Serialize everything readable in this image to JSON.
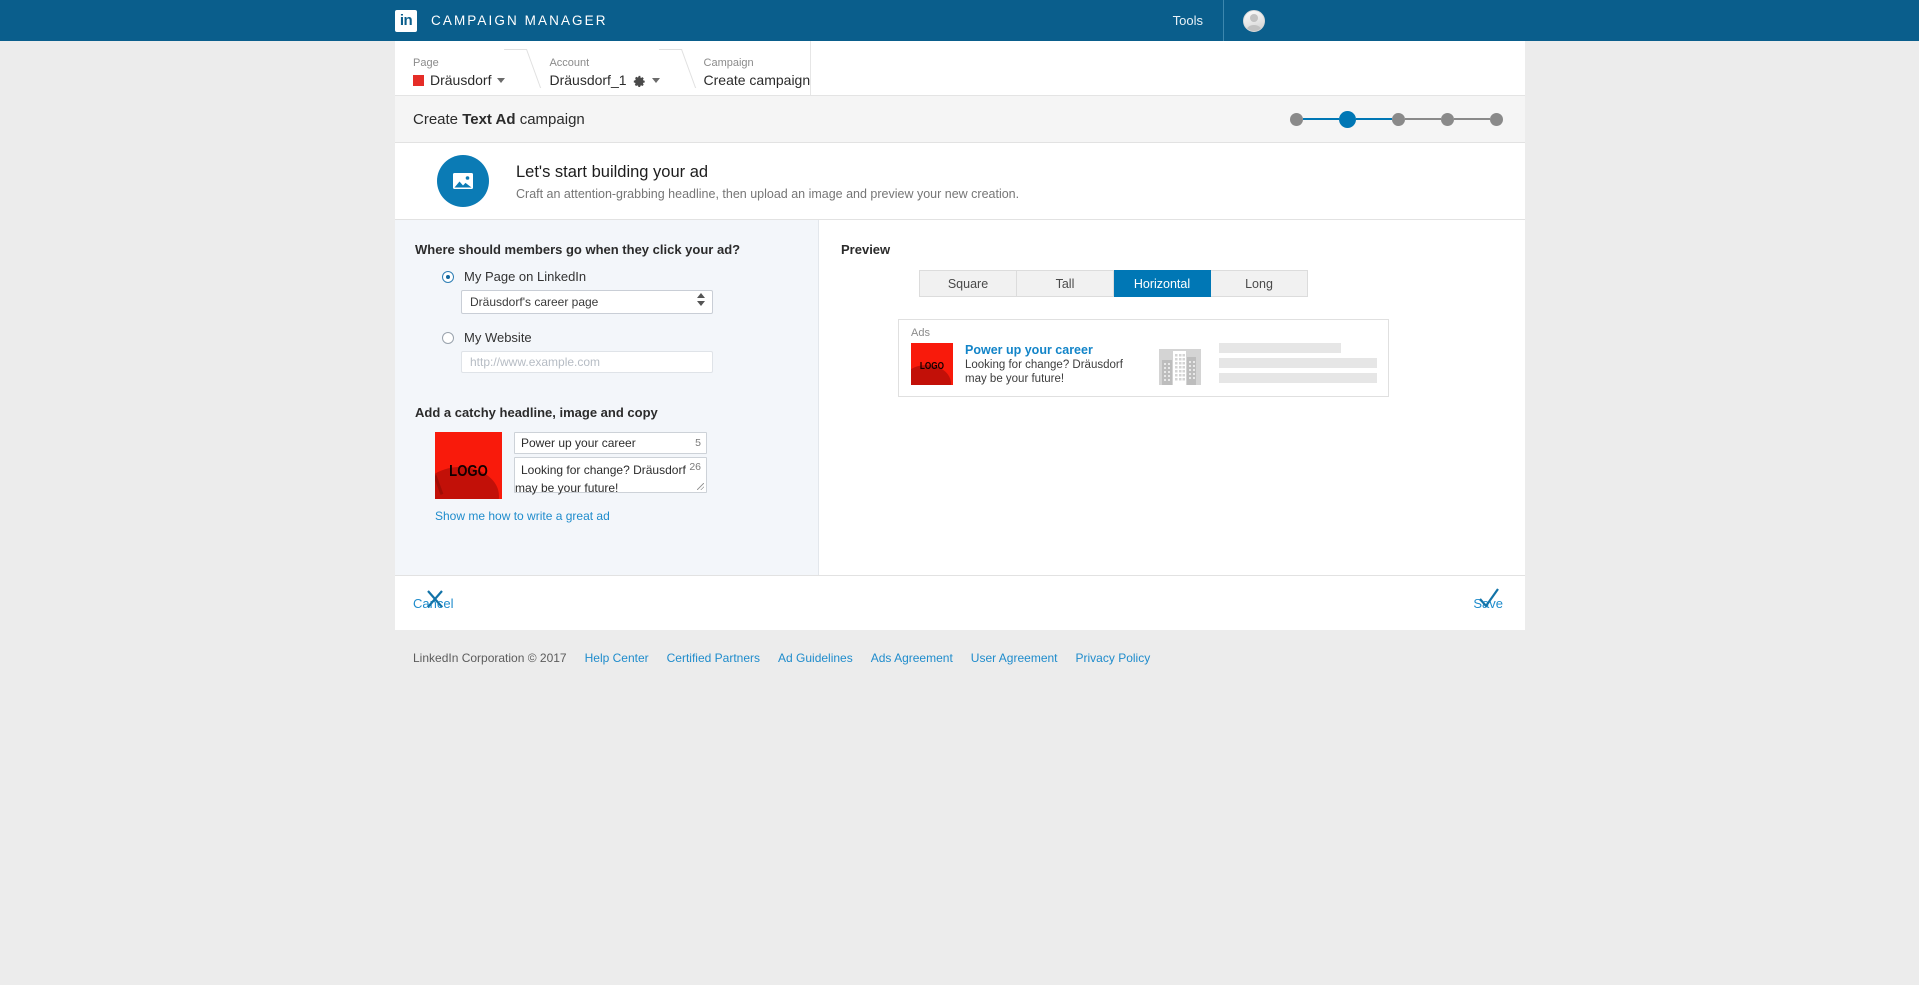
{
  "topnav": {
    "logo_text": "in",
    "brand": "CAMPAIGN MANAGER",
    "tools_label": "Tools",
    "brand_color": "#0a5e8c"
  },
  "breadcrumb": {
    "items": [
      {
        "label": "Page",
        "value": "Dräusdorf"
      },
      {
        "label": "Account",
        "value": "Dräusdorf_1"
      },
      {
        "label": "Campaign",
        "value": "Create campaign"
      }
    ]
  },
  "campaign_header": {
    "title_prefix": "Create ",
    "title_bold": "Text Ad",
    "title_suffix": " campaign",
    "total_steps": 5,
    "active_step": 2,
    "active_color": "#0077b5"
  },
  "hero": {
    "title": "Let's start building your ad",
    "subtitle": "Craft an attention-grabbing headline, then upload an image and preview your new creation."
  },
  "destination": {
    "section_title": "Where should members go when they click your ad?",
    "option_page_label": "My Page on LinkedIn",
    "page_select_value": "Dräusdorf's career page",
    "option_website_label": "My Website",
    "website_placeholder": "http://www.example.com"
  },
  "creative": {
    "section_title": "Add a catchy headline, image and copy",
    "logo_text": "LOGO",
    "headline_value": "Power up your career",
    "headline_counter": "5",
    "body_value": "Looking for change? Dräusdorf may be your future!",
    "body_counter": "26",
    "help_link": "Show me how to write a great ad"
  },
  "preview": {
    "title": "Preview",
    "tabs": [
      {
        "label": "Square",
        "active": false
      },
      {
        "label": "Tall",
        "active": false
      },
      {
        "label": "Horizontal",
        "active": true
      },
      {
        "label": "Long",
        "active": false
      }
    ],
    "ads_label": "Ads",
    "ad_logo_text": "LOGO",
    "ad_headline": "Power up your career",
    "ad_description": "Looking for change? Dräusdorf may be your future!"
  },
  "actions": {
    "cancel_label": "Cancel",
    "save_label": "Save"
  },
  "footer": {
    "copyright": "LinkedIn Corporation © 2017",
    "links": [
      "Help Center",
      "Certified Partners",
      "Ad Guidelines",
      "Ads Agreement",
      "User Agreement",
      "Privacy Policy"
    ]
  }
}
